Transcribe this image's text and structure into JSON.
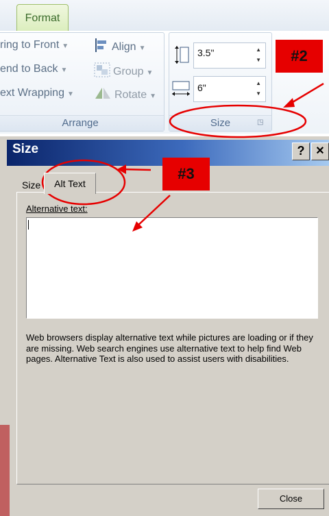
{
  "ribbon": {
    "tab_label": "Format",
    "arrange": {
      "bring_front": "ring to Front",
      "send_back": "end to Back",
      "text_wrapping": "ext Wrapping",
      "align": "Align",
      "group": "Group",
      "rotate": "Rotate",
      "label": "Arrange"
    },
    "size": {
      "height_value": "3.5\"",
      "width_value": "6\"",
      "label": "Size"
    }
  },
  "annotations": {
    "badge2": "#2",
    "badge3": "#3",
    "color": "#e60000"
  },
  "dialog": {
    "title": "Size",
    "help_button": "?",
    "close_x": "✕",
    "tabs": [
      "Size",
      "Alt Text"
    ],
    "alt_label": "Alternative text:",
    "alt_value": "",
    "description": "Web browsers display alternative text while pictures are loading or if they are missing.  Web search engines use alternative text to help find Web pages.  Alternative Text is also used to assist users with disabilities.",
    "close_button": "Close"
  }
}
